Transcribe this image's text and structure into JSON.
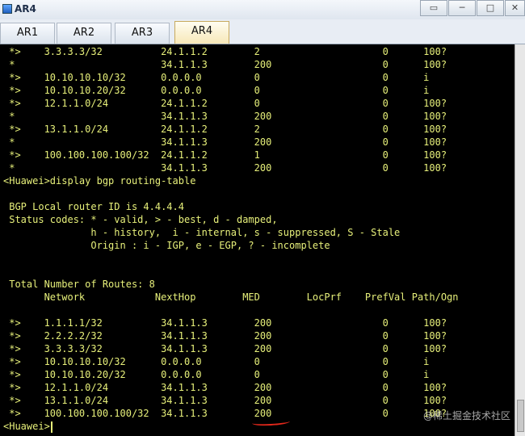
{
  "window": {
    "title": "AR4",
    "controls": [
      "▭",
      "─",
      "□",
      "✕"
    ]
  },
  "tabs": [
    "AR1",
    "AR2",
    "AR3",
    "AR4"
  ],
  "active_tab": "AR4",
  "terminal": {
    "lines": [
      " *>    3.3.3.3/32          24.1.1.2        2                     0      100?",
      " *                         34.1.1.3        200                   0      100?",
      " *>    10.10.10.10/32      0.0.0.0         0                     0      i",
      " *>    10.10.10.20/32      0.0.0.0         0                     0      i",
      " *>    12.1.1.0/24         24.1.1.2        0                     0      100?",
      " *                         34.1.1.3        200                   0      100?",
      " *>    13.1.1.0/24         24.1.1.2        2                     0      100?",
      " *                         34.1.1.3        200                   0      100?",
      " *>    100.100.100.100/32  24.1.1.2        1                     0      100?",
      " *                         34.1.1.3        200                   0      100?",
      "<Huawei>display bgp routing-table",
      "",
      " BGP Local router ID is 4.4.4.4",
      " Status codes: * - valid, > - best, d - damped,",
      "               h - history,  i - internal, s - suppressed, S - Stale",
      "               Origin : i - IGP, e - EGP, ? - incomplete",
      "",
      "",
      " Total Number of Routes: 8",
      "       Network            NextHop        MED        LocPrf    PrefVal Path/Ogn",
      "",
      " *>    1.1.1.1/32          34.1.1.3        200                   0      100?",
      " *>    2.2.2.2/32          34.1.1.3        200                   0      100?",
      " *>    3.3.3.3/32          34.1.1.3        200                   0      100?",
      " *>    10.10.10.10/32      0.0.0.0         0                     0      i",
      " *>    10.10.10.20/32      0.0.0.0         0                     0      i",
      " *>    12.1.1.0/24         34.1.1.3        200                   0      100?",
      " *>    13.1.1.0/24         34.1.1.3        200                   0      100?",
      " *>    100.100.100.100/32  34.1.1.3        200                   0      100?",
      "<Huawei>"
    ]
  },
  "watermark": "@稀土掘金技术社区",
  "colors": {
    "terminal_bg": "#000000",
    "terminal_text": "#e7f07a",
    "accent_active_tab": "#f7e8b8",
    "annotation_underline": "#e4281b"
  }
}
